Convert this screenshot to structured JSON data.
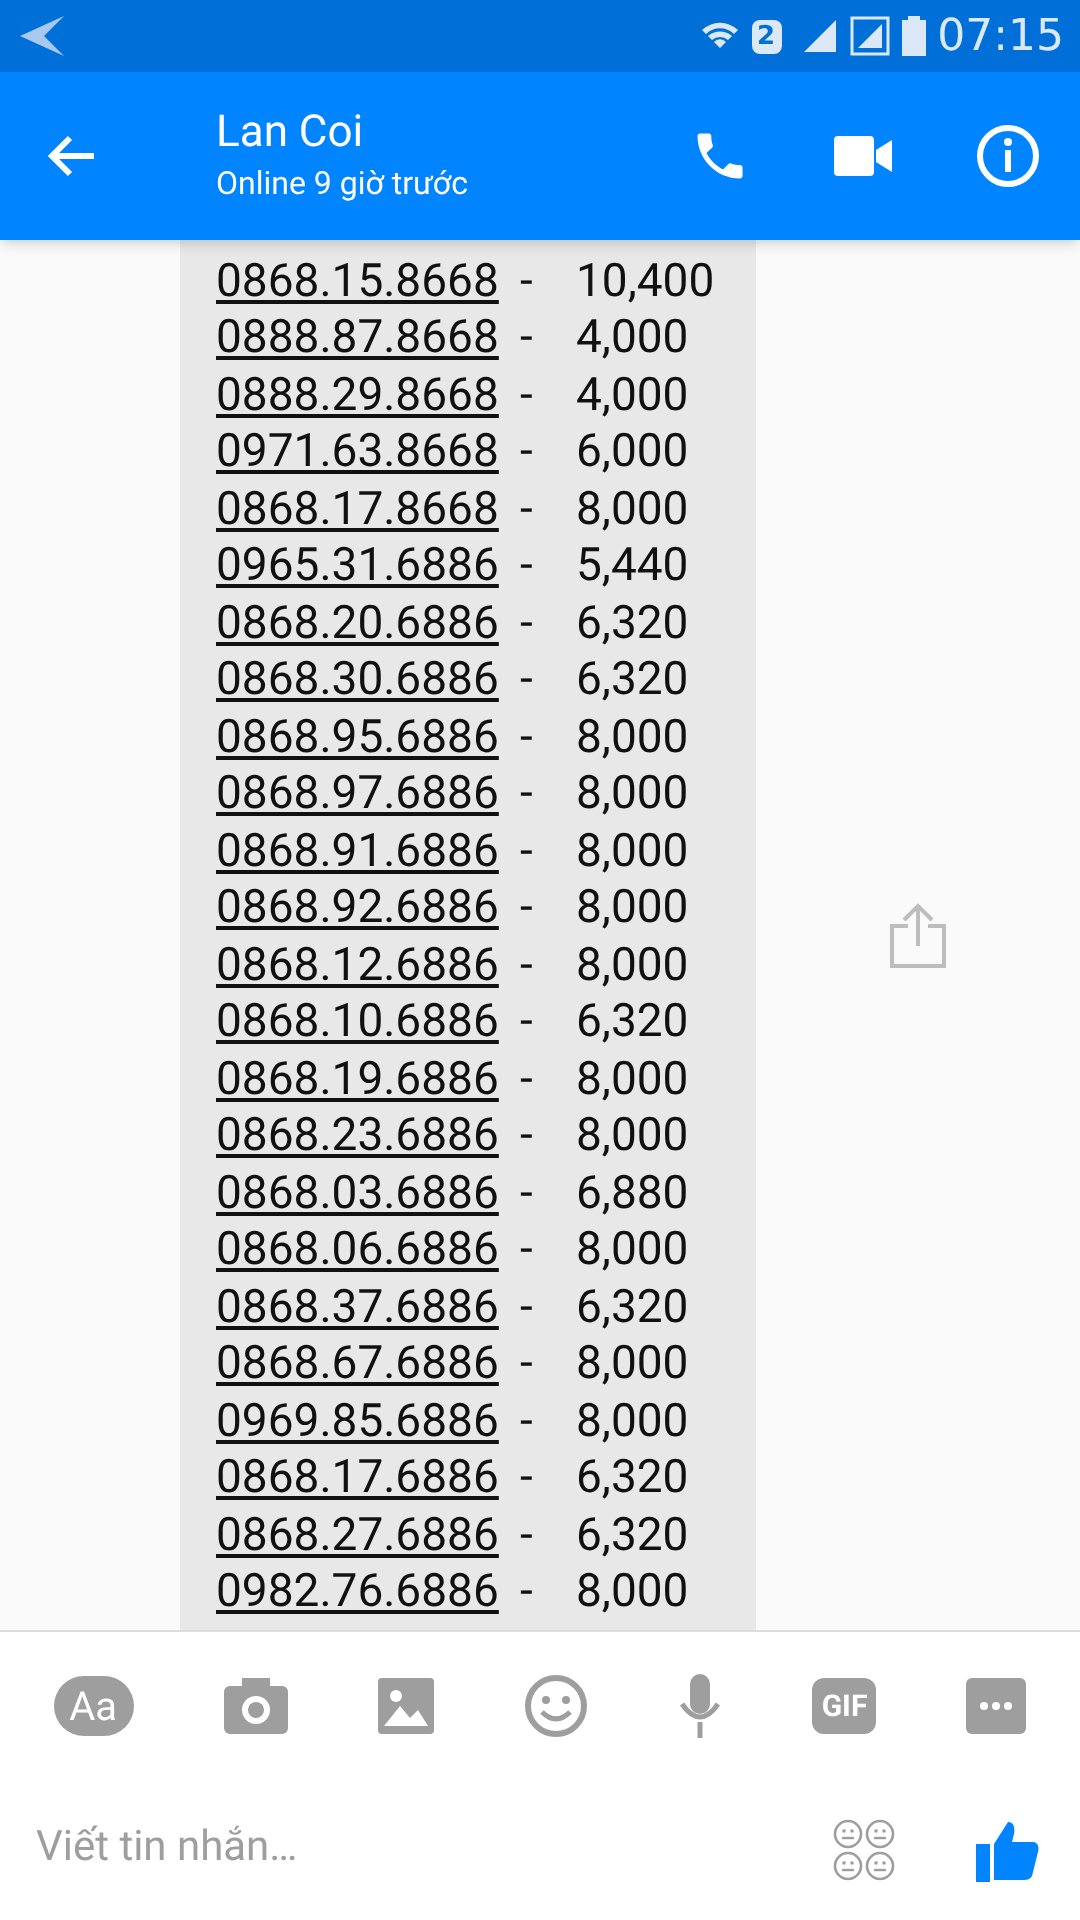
{
  "status_bar": {
    "sim": "2",
    "time": "07:15"
  },
  "header": {
    "name": "Lan Coi",
    "status": "Online 9 giờ trước"
  },
  "message": {
    "rows": [
      {
        "number": "0868.15.8668",
        "separator": "-",
        "price": "10,400"
      },
      {
        "number": "0888.87.8668",
        "separator": "-",
        "price": "4,000"
      },
      {
        "number": "0888.29.8668",
        "separator": "-",
        "price": "4,000"
      },
      {
        "number": "0971.63.8668",
        "separator": "-",
        "price": "6,000"
      },
      {
        "number": "0868.17.8668",
        "separator": "-",
        "price": "8,000"
      },
      {
        "number": "0965.31.6886",
        "separator": "-",
        "price": "5,440"
      },
      {
        "number": "0868.20.6886",
        "separator": "-",
        "price": "6,320"
      },
      {
        "number": "0868.30.6886",
        "separator": "-",
        "price": "6,320"
      },
      {
        "number": "0868.95.6886",
        "separator": "-",
        "price": "8,000"
      },
      {
        "number": "0868.97.6886",
        "separator": "-",
        "price": "8,000"
      },
      {
        "number": "0868.91.6886",
        "separator": "-",
        "price": "8,000"
      },
      {
        "number": "0868.92.6886",
        "separator": "-",
        "price": "8,000"
      },
      {
        "number": "0868.12.6886",
        "separator": "-",
        "price": "8,000"
      },
      {
        "number": "0868.10.6886",
        "separator": "-",
        "price": "6,320"
      },
      {
        "number": "0868.19.6886",
        "separator": "-",
        "price": "8,000"
      },
      {
        "number": "0868.23.6886",
        "separator": "-",
        "price": "8,000"
      },
      {
        "number": "0868.03.6886",
        "separator": "-",
        "price": "6,880"
      },
      {
        "number": "0868.06.6886",
        "separator": "-",
        "price": "8,000"
      },
      {
        "number": "0868.37.6886",
        "separator": "-",
        "price": "6,320"
      },
      {
        "number": "0868.67.6886",
        "separator": "-",
        "price": "8,000"
      },
      {
        "number": "0969.85.6886",
        "separator": "-",
        "price": "8,000"
      },
      {
        "number": "0868.17.6886",
        "separator": "-",
        "price": "6,320"
      },
      {
        "number": "0868.27.6886",
        "separator": "-",
        "price": "6,320"
      },
      {
        "number": "0982.76.6886",
        "separator": "-",
        "price": "8,000"
      }
    ]
  },
  "toolbar": {
    "text_button": "Aa",
    "gif_button": "GIF"
  },
  "composer": {
    "placeholder": "Viết tin nhắn…"
  }
}
